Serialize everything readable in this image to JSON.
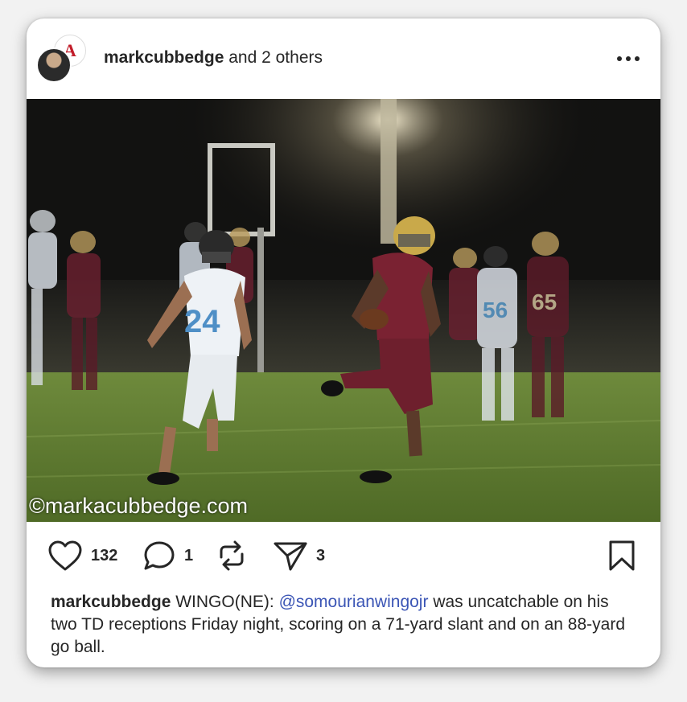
{
  "post": {
    "author": "markcubbedge",
    "coauthors_text": "and 2 others",
    "second_avatar_letter": "A",
    "watermark": "©markacubbedge.com",
    "likes": "132",
    "comments": "1",
    "shares": "3",
    "caption": {
      "author": "markcubbedge",
      "text_before": "WINGO(NE):",
      "mention": "@somourianwingojr",
      "text_after": "was uncatchable on his two TD receptions Friday night, scoring on a 71-yard slant and on an 88-yard go ball."
    }
  },
  "icons": {
    "more": "more-horizontal-icon",
    "like": "heart-icon",
    "comment": "comment-icon",
    "repost": "repost-icon",
    "share": "send-icon",
    "save": "bookmark-icon"
  },
  "colors": {
    "mention": "#3b55b5",
    "jersey_maroon": "#7a2232",
    "jersey_white": "#e9eef4",
    "field_green": "#5f7a33"
  }
}
